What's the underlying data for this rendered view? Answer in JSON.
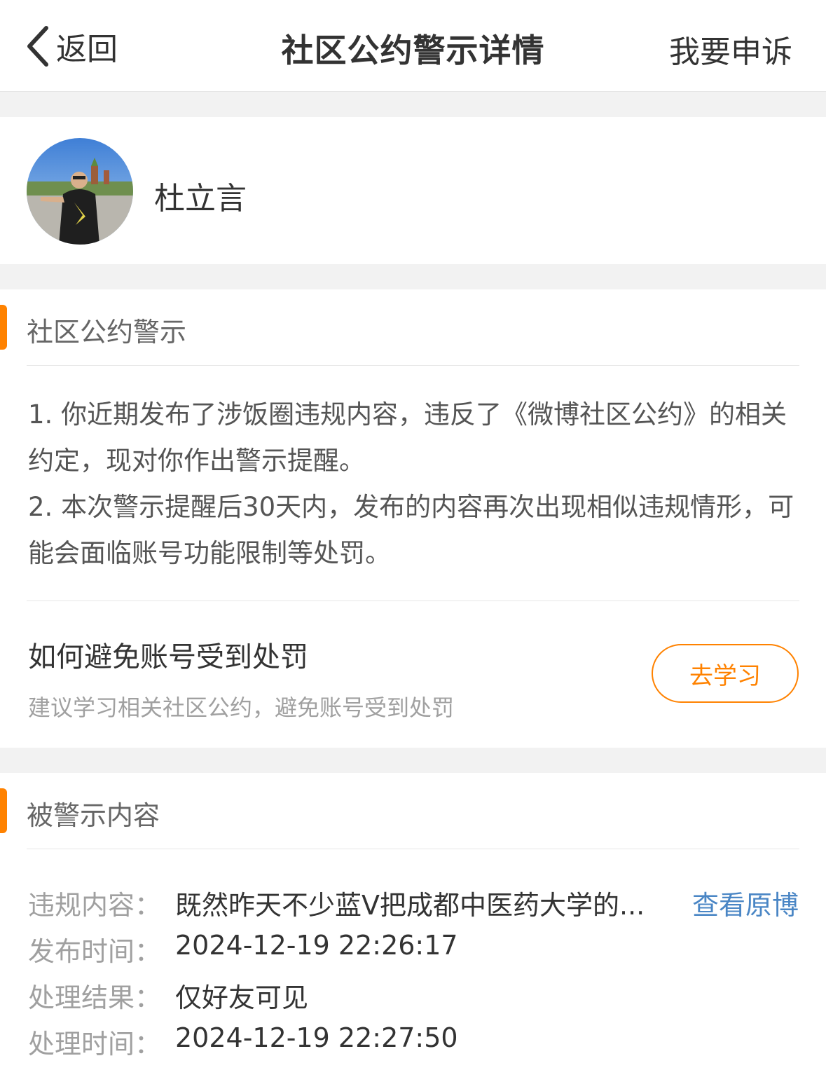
{
  "navbar": {
    "back_label": "返回",
    "title": "社区公约警示详情",
    "appeal_label": "我要申诉"
  },
  "user": {
    "name": "杜立言"
  },
  "warning_section": {
    "title": "社区公约警示",
    "paragraphs": [
      "1. 你近期发布了涉饭圈违规内容，违反了《微博社区公约》的相关约定，现对你作出警示提醒。",
      "2. 本次警示提醒后30天内，发布的内容再次出现相似违规情形，可能会面临账号功能限制等处罚。"
    ],
    "learn": {
      "title": "如何避免账号受到处罚",
      "subtitle": "建议学习相关社区公约，避免账号受到处罚",
      "button_label": "去学习"
    }
  },
  "content_section": {
    "title": "被警示内容",
    "rows": [
      {
        "label": "违规内容：",
        "value": "既然昨天不少蓝V把成都中医药大学的..."
      },
      {
        "label": "发布时间：",
        "value": "2024-12-19 22:26:17"
      },
      {
        "label": "处理结果：",
        "value": "仅好友可见"
      },
      {
        "label": "处理时间：",
        "value": "2024-12-19 22:27:50"
      }
    ],
    "view_original_label": "查看原博"
  },
  "colors": {
    "accent": "#ff8200",
    "link": "#4a86c5",
    "background": "#f2f2f2"
  },
  "icons": {
    "back": "chevron-left-icon"
  }
}
